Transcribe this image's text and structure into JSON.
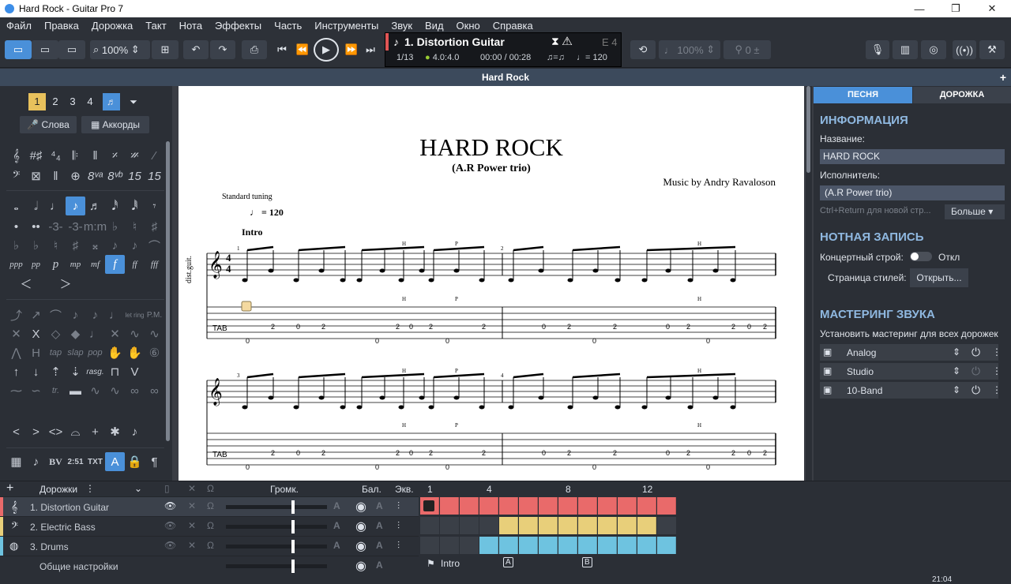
{
  "window": {
    "title": "Hard Rock - Guitar Pro 7"
  },
  "menu": [
    "Файл",
    "Правка",
    "Дорожка",
    "Такт",
    "Нота",
    "Эффекты",
    "Часть",
    "Инструменты",
    "Звук",
    "Вид",
    "Окно",
    "Справка"
  ],
  "toolbar": {
    "zoom": "100%",
    "speed": "100%",
    "tuner_val": "0"
  },
  "lcd": {
    "track": "1. Distortion Guitar",
    "bar": "1/13",
    "sig": "4.0:4.0",
    "time": "00:00 / 00:28",
    "tempo_eq": "♫=♫",
    "tempo": "♩= 120",
    "note": "E 4"
  },
  "doc_tab": "Hard Rock",
  "left": {
    "voices": [
      "1",
      "2",
      "3",
      "4"
    ],
    "lyrics": "Слова",
    "chords": "Аккорды"
  },
  "score": {
    "title": "HARD ROCK",
    "subtitle": "(A.R Power trio)",
    "composer": "Music by Andry Ravaloson",
    "tuning": "Standard tuning",
    "tempo": "= 120",
    "section": "Intro",
    "track_short": "dist.guit.",
    "hammer": "H",
    "pull": "P",
    "bar_nums": [
      "1",
      "2",
      "3",
      "4"
    ],
    "tab_row1": [
      "0",
      "2",
      "0",
      "2",
      "0",
      "2",
      "0",
      "2",
      "0",
      "2",
      "0",
      "2",
      "0",
      "2",
      "0",
      "2",
      "0",
      "2",
      "0",
      "2"
    ],
    "tab_row2": [
      "0",
      "2",
      "0",
      "2",
      "0",
      "2",
      "0",
      "2",
      "0",
      "2",
      "0",
      "2",
      "0",
      "2",
      "0",
      "2",
      "0",
      "2",
      "0",
      "2"
    ]
  },
  "right": {
    "tab_song": "ПЕСНЯ",
    "tab_track": "ДОРОЖКА",
    "info_h": "ИНФОРМАЦИЯ",
    "name_label": "Название:",
    "name_value": "HARD ROCK",
    "artist_label": "Исполнитель:",
    "artist_value": "(A.R Power trio)",
    "hint": "Ctrl+Return для новой стр...",
    "more": "Больше",
    "notation_h": "НОТНАЯ ЗАПИСЬ",
    "concert_label": "Концертный строй:",
    "concert_value": "Откл",
    "stylesheet_label": "Страница стилей:",
    "stylesheet_btn": "Открыть...",
    "master_h": "МАСТЕРИНГ ЗВУКА",
    "master_desc": "Установить  мастеринг для всех дорожек",
    "master": [
      "Analog",
      "Studio",
      "10-Band"
    ]
  },
  "tracks": {
    "header": "Дорожки",
    "vol": "Громк.",
    "bal": "Бал.",
    "eq": "Экв.",
    "ruler": [
      "1",
      "4",
      "8",
      "12"
    ],
    "list": [
      "1. Distortion Guitar",
      "2. Electric Bass",
      "3. Drums"
    ],
    "general": "Общие настройки",
    "markers": [
      "Intro",
      "A",
      "B"
    ],
    "colors": {
      "guitar": "#e96a6a",
      "bass": "#e8cf7a",
      "drums": "#6ec3e0"
    }
  },
  "clock": "21:04"
}
